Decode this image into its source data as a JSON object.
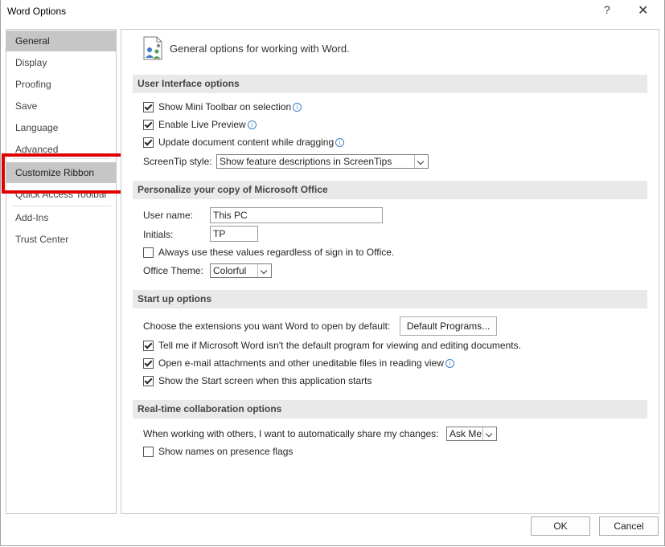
{
  "window": {
    "title": "Word Options",
    "help": "?",
    "close": "✕"
  },
  "nav": {
    "items": [
      "General",
      "Display",
      "Proofing",
      "Save",
      "Language",
      "Advanced",
      "Customize Ribbon",
      "Quick Access Toolbar",
      "Add-Ins",
      "Trust Center"
    ],
    "selected": "General",
    "highlight_color": "#e00000"
  },
  "header": {
    "text": "General options for working with Word.",
    "icon": "options-people-icon"
  },
  "ui_options": {
    "title": "User Interface options",
    "mini_toolbar": "Show Mini Toolbar on selection",
    "live_preview": "Enable Live Preview",
    "update_dragging": "Update document content while dragging",
    "screentip_label": "ScreenTip style:",
    "screentip_value": "Show feature descriptions in ScreenTips"
  },
  "personalize": {
    "title": "Personalize your copy of Microsoft Office",
    "username_label": "User name:",
    "username_value": "This PC",
    "initials_label": "Initials:",
    "initials_value": "TP",
    "always_use": "Always use these values regardless of sign in to Office.",
    "theme_label": "Office Theme:",
    "theme_value": "Colorful"
  },
  "startup": {
    "title": "Start up options",
    "extensions_label": "Choose the extensions you want Word to open by default:",
    "default_programs": "Default Programs...",
    "tell_me": "Tell me if Microsoft Word isn't the default program for viewing and editing documents.",
    "open_email": "Open e-mail attachments and other uneditable files in reading view",
    "show_start": "Show the Start screen when this application starts"
  },
  "collab": {
    "title": "Real-time collaboration options",
    "share_label": "When working with others, I want to automatically share my changes:",
    "share_value": "Ask Me",
    "presence_flags": "Show names on presence flags"
  },
  "footer": {
    "ok": "OK",
    "cancel": "Cancel"
  }
}
